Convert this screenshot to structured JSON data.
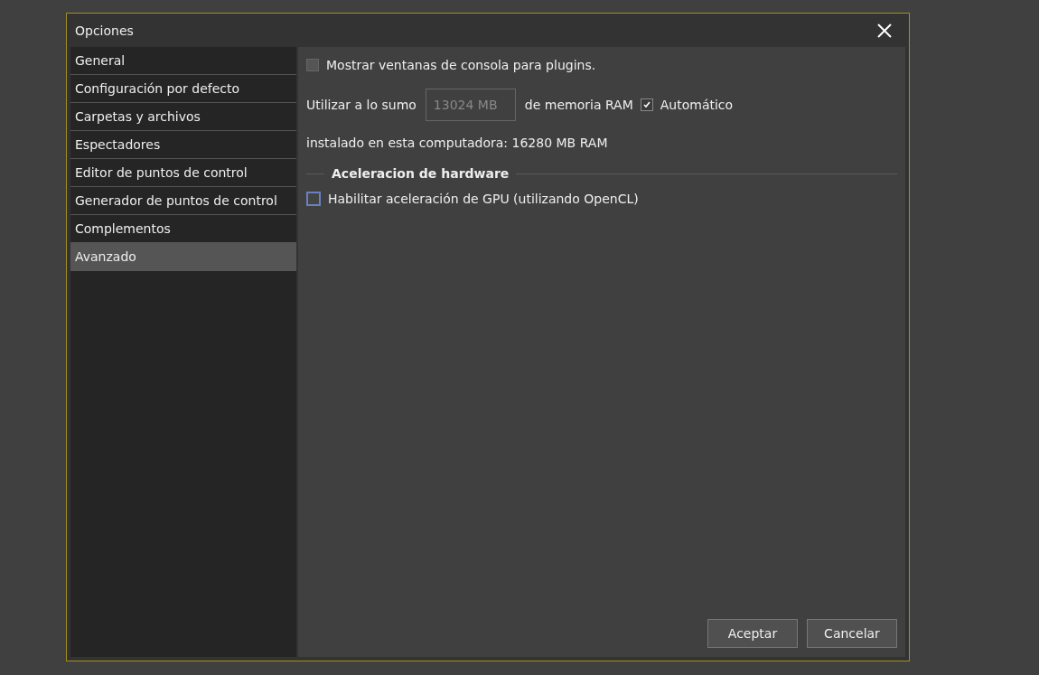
{
  "window": {
    "title": "Opciones"
  },
  "sidebar": {
    "items": [
      {
        "label": "General",
        "selected": false
      },
      {
        "label": "Configuración por defecto",
        "selected": false
      },
      {
        "label": "Carpetas y archivos",
        "selected": false
      },
      {
        "label": "Espectadores",
        "selected": false
      },
      {
        "label": "Editor de puntos de control",
        "selected": false
      },
      {
        "label": "Generador de puntos de control",
        "selected": false
      },
      {
        "label": "Complementos",
        "selected": false
      },
      {
        "label": "Avanzado",
        "selected": true
      }
    ]
  },
  "console_option": {
    "label": "Mostrar ventanas de consola para plugins.",
    "checked": false
  },
  "memory": {
    "prefix": "Utilizar a lo sumo",
    "value": "13024 MB",
    "disabled": true,
    "suffix": "de memoria RAM",
    "auto": {
      "label": "Automático",
      "checked": true
    }
  },
  "installed": "instalado en esta computadora: 16280 MB RAM",
  "hardware_section": {
    "title": "Aceleracion de hardware",
    "gpu_option": {
      "label": "Habilitar aceleración de GPU (utilizando OpenCL)",
      "checked": false,
      "focused": true
    }
  },
  "buttons": [
    "Aceptar",
    "Cancelar"
  ]
}
